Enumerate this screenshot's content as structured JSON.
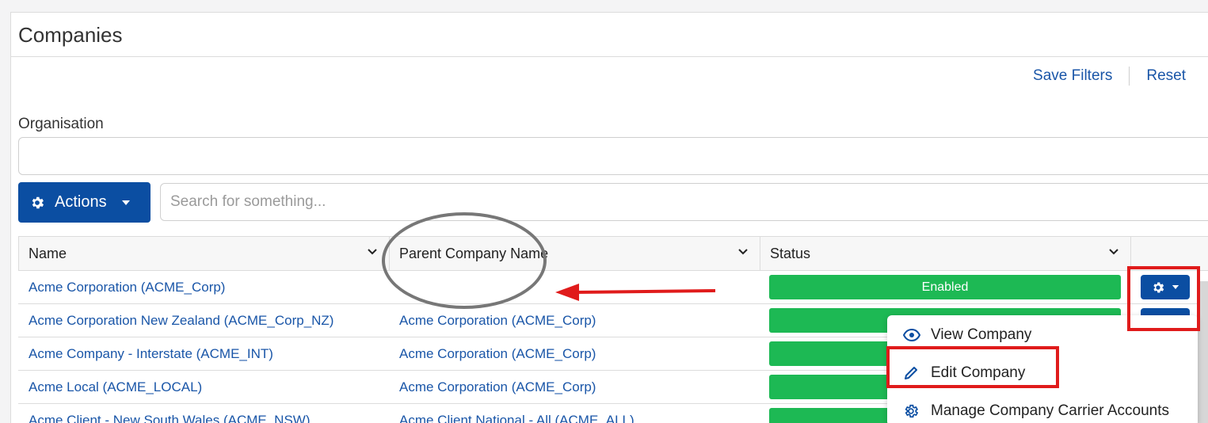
{
  "page": {
    "title": "Companies"
  },
  "filters": {
    "save_label": "Save Filters",
    "reset_label": "Reset",
    "organisation_label": "Organisation",
    "organisation_value": ""
  },
  "toolbar": {
    "actions_label": "Actions",
    "search_placeholder": "Search for something..."
  },
  "table": {
    "columns": [
      {
        "label": "Name"
      },
      {
        "label": "Parent Company Name"
      },
      {
        "label": "Status"
      }
    ],
    "rows": [
      {
        "name": "Acme Corporation (ACME_Corp)",
        "parent": "",
        "status": "Enabled"
      },
      {
        "name": "Acme Corporation New Zealand (ACME_Corp_NZ)",
        "parent": "Acme Corporation (ACME_Corp)",
        "status": ""
      },
      {
        "name": "Acme Company - Interstate (ACME_INT)",
        "parent": "Acme Corporation (ACME_Corp)",
        "status": ""
      },
      {
        "name": "Acme Local (ACME_LOCAL)",
        "parent": "Acme Corporation (ACME_Corp)",
        "status": ""
      },
      {
        "name": "Acme Client - New South Wales (ACME_NSW)",
        "parent": "Acme Client National - All (ACME_ALL)",
        "status": ""
      }
    ]
  },
  "row_menu": {
    "items": [
      {
        "label": "View Company",
        "icon": "eye-icon"
      },
      {
        "label": "Edit Company",
        "icon": "pencil-icon"
      },
      {
        "label": "Manage Company Carrier Accounts",
        "icon": "gear-icon"
      }
    ]
  },
  "colors": {
    "primary": "#0b4ea2",
    "link": "#1a56a8",
    "enabled": "#1db954",
    "annotation_red": "#e01b1b",
    "annotation_gray": "#777777"
  }
}
